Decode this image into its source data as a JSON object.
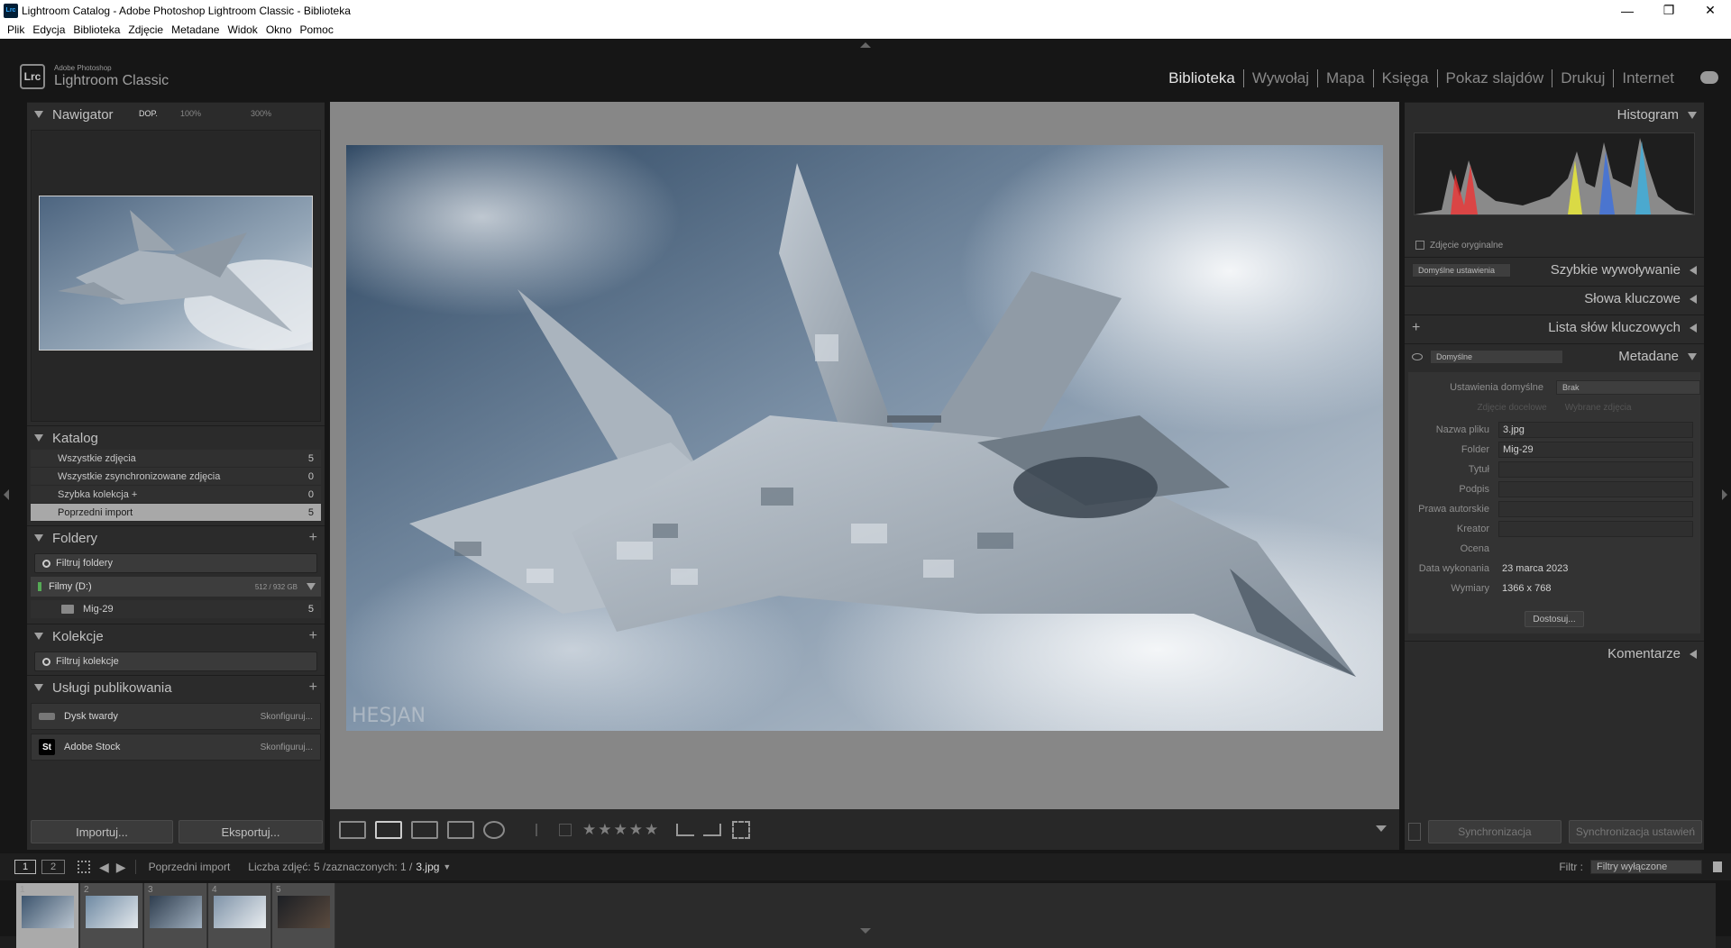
{
  "window": {
    "title": "Lightroom Catalog - Adobe Photoshop Lightroom Classic - Biblioteka",
    "app_icon": "Lrc"
  },
  "menu": [
    "Plik",
    "Edycja",
    "Biblioteka",
    "Zdjęcie",
    "Metadane",
    "Widok",
    "Okno",
    "Pomoc"
  ],
  "identity": {
    "badge": "Lrc",
    "line1": "Adobe Photoshop",
    "line2": "Lightroom Classic"
  },
  "modules": [
    "Biblioteka",
    "Wywołaj",
    "Mapa",
    "Księga",
    "Pokaz slajdów",
    "Drukuj",
    "Internet"
  ],
  "active_module": "Biblioteka",
  "navigator": {
    "title": "Nawigator",
    "zoom1": "DOP.",
    "zoom2": "100%",
    "zoom3": "300%"
  },
  "catalog": {
    "title": "Katalog",
    "rows": [
      {
        "label": "Wszystkie zdjęcia",
        "count": "5"
      },
      {
        "label": "Wszystkie zsynchronizowane zdjęcia",
        "count": "0"
      },
      {
        "label": "Szybka kolekcja  +",
        "count": "0"
      },
      {
        "label": "Poprzedni import",
        "count": "5"
      }
    ]
  },
  "folders": {
    "title": "Foldery",
    "filter": "Filtruj foldery",
    "volume": {
      "name": "Filmy (D:)",
      "info": "512 / 932 GB"
    },
    "items": [
      {
        "name": "Mig-29",
        "count": "5"
      }
    ]
  },
  "collections": {
    "title": "Kolekcje",
    "filter": "Filtruj kolekcje"
  },
  "publish": {
    "title": "Usługi publikowania",
    "items": [
      {
        "name": "Dysk twardy",
        "action": "Skonfiguruj..."
      },
      {
        "name": "Adobe Stock",
        "action": "Skonfiguruj..."
      }
    ]
  },
  "left_buttons": {
    "import": "Importuj...",
    "export": "Eksportuj..."
  },
  "right": {
    "histogram": "Histogram",
    "original_photo": "Zdjęcie oryginalne",
    "quick_develop": {
      "title": "Szybkie wywoływanie",
      "preset": "Domyślne ustawienia"
    },
    "keywords": "Słowa kluczowe",
    "keyword_list": "Lista słów kluczowych",
    "metadata": {
      "title": "Metadane",
      "preset": "Domyślne",
      "defaults_label": "Ustawienia domyślne",
      "defaults_value": "Brak",
      "target1": "Zdjęcie docelowe",
      "target2": "Wybrane zdjęcia",
      "fields": [
        {
          "label": "Nazwa pliku",
          "value": "3.jpg"
        },
        {
          "label": "Folder",
          "value": "Mig-29"
        },
        {
          "label": "Tytuł",
          "value": ""
        },
        {
          "label": "Podpis",
          "value": ""
        },
        {
          "label": "Prawa autorskie",
          "value": ""
        },
        {
          "label": "Kreator",
          "value": ""
        },
        {
          "label": "Ocena",
          "value": ""
        },
        {
          "label": "Data wykonania",
          "value": "23 marca 2023"
        },
        {
          "label": "Wymiary",
          "value": "1366 x 768"
        }
      ],
      "customize": "Dostosuj..."
    },
    "comments": "Komentarze",
    "sync": "Synchronizacja",
    "sync_settings": "Synchronizacja ustawień"
  },
  "toolbar": {
    "stars": "★★★★★"
  },
  "filmbar": {
    "page1": "1",
    "page2": "2",
    "source": "Poprzedni import",
    "summary": "Liczba zdjęć: 5 /zaznaczonych: 1 /",
    "current": "3.jpg",
    "filter_label": "Filtr :",
    "filter_value": "Filtry wyłączone"
  },
  "filmstrip": [
    {
      "num": "1",
      "selected": true
    },
    {
      "num": "2",
      "selected": false
    },
    {
      "num": "3",
      "selected": false
    },
    {
      "num": "4",
      "selected": false
    },
    {
      "num": "5",
      "selected": false
    }
  ],
  "watermark": "HESJAN"
}
